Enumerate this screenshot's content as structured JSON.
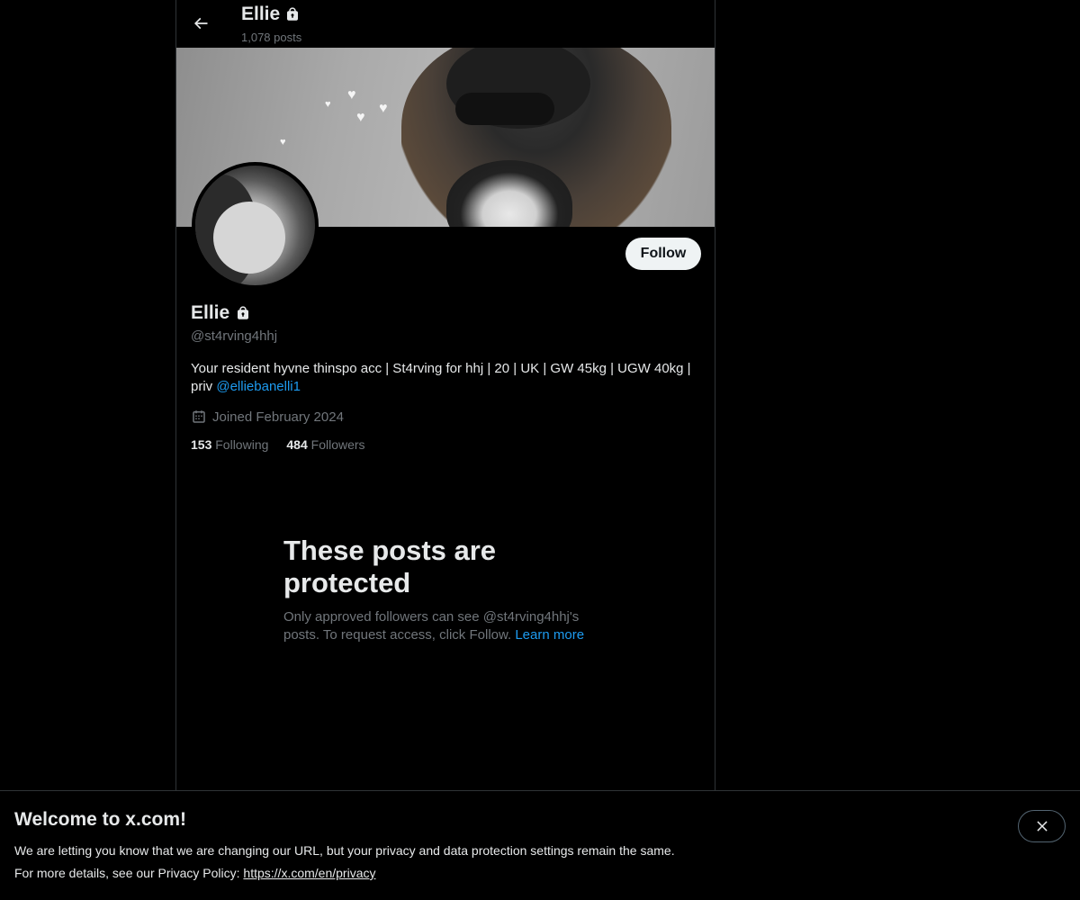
{
  "header": {
    "name": "Ellie",
    "post_count": "1,078 posts"
  },
  "profile": {
    "display_name": "Ellie",
    "handle": "@st4rving4hhj",
    "bio_text": "Your resident hyvne thinspo acc | St4rving for hhj | 20 | UK | GW 45kg | UGW 40kg | priv ",
    "bio_mention": "@elliebanelli1",
    "joined": "Joined February 2024",
    "follow_label": "Follow",
    "following_count": "153",
    "following_label": "Following",
    "followers_count": "484",
    "followers_label": "Followers"
  },
  "protected": {
    "title": "These posts are protected",
    "description": "Only approved followers can see @st4rving4hhj's posts. To request access, click Follow. ",
    "learn_more": "Learn more"
  },
  "notice": {
    "title": "Welcome to x.com!",
    "line1": "We are letting you know that we are changing our URL, but your privacy and data protection settings remain the same.",
    "line2_prefix": "For more details, see our Privacy Policy: ",
    "privacy_link": "https://x.com/en/privacy"
  },
  "colors": {
    "background": "#000000",
    "text_primary": "#e7e9ea",
    "text_secondary": "#71767b",
    "link": "#1d9bf0",
    "border": "#2f3336"
  },
  "icons": [
    "back-arrow-icon",
    "lock-icon",
    "calendar-icon",
    "close-icon"
  ]
}
